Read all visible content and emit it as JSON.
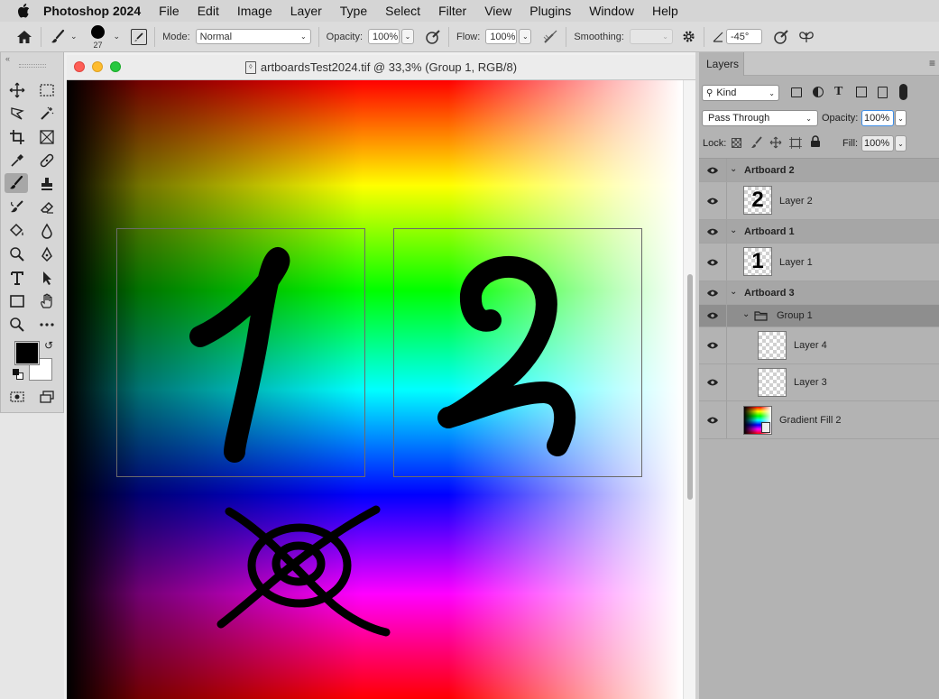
{
  "menubar": {
    "app_name": "Photoshop 2024",
    "items": [
      "File",
      "Edit",
      "Image",
      "Layer",
      "Type",
      "Select",
      "Filter",
      "View",
      "Plugins",
      "Window",
      "Help"
    ]
  },
  "options_bar": {
    "brush_size": "27",
    "mode_label": "Mode:",
    "mode_value": "Normal",
    "opacity_label": "Opacity:",
    "opacity_value": "100%",
    "flow_label": "Flow:",
    "flow_value": "100%",
    "smoothing_label": "Smoothing:",
    "smoothing_value": "",
    "angle_value": "-45°"
  },
  "document": {
    "title": "artboardsTest2024.tif @ 33,3% (Group 1, RGB/8)"
  },
  "layers_panel": {
    "tab_label": "Layers",
    "filter_kind": "Kind",
    "blend_mode": "Pass Through",
    "opacity_label": "Opacity:",
    "opacity_value": "100%",
    "lock_label": "Lock:",
    "fill_label": "Fill:",
    "fill_value": "100%",
    "rows": [
      {
        "type": "artboard",
        "name": "Artboard 2"
      },
      {
        "type": "layer",
        "name": "Layer 2",
        "thumb_glyph": "2"
      },
      {
        "type": "artboard",
        "name": "Artboard 1"
      },
      {
        "type": "layer",
        "name": "Layer 1",
        "thumb_glyph": "1"
      },
      {
        "type": "artboard",
        "name": "Artboard 3"
      },
      {
        "type": "group",
        "name": "Group 1",
        "selected": true
      },
      {
        "type": "layer",
        "name": "Layer 4"
      },
      {
        "type": "layer",
        "name": "Layer 3"
      },
      {
        "type": "fill",
        "name": "Gradient Fill 2"
      }
    ]
  },
  "colors": {
    "foreground": "#000000",
    "background": "#ffffff",
    "selected_row": "#8e8e8e",
    "artboard_row": "#a6a6a6"
  }
}
